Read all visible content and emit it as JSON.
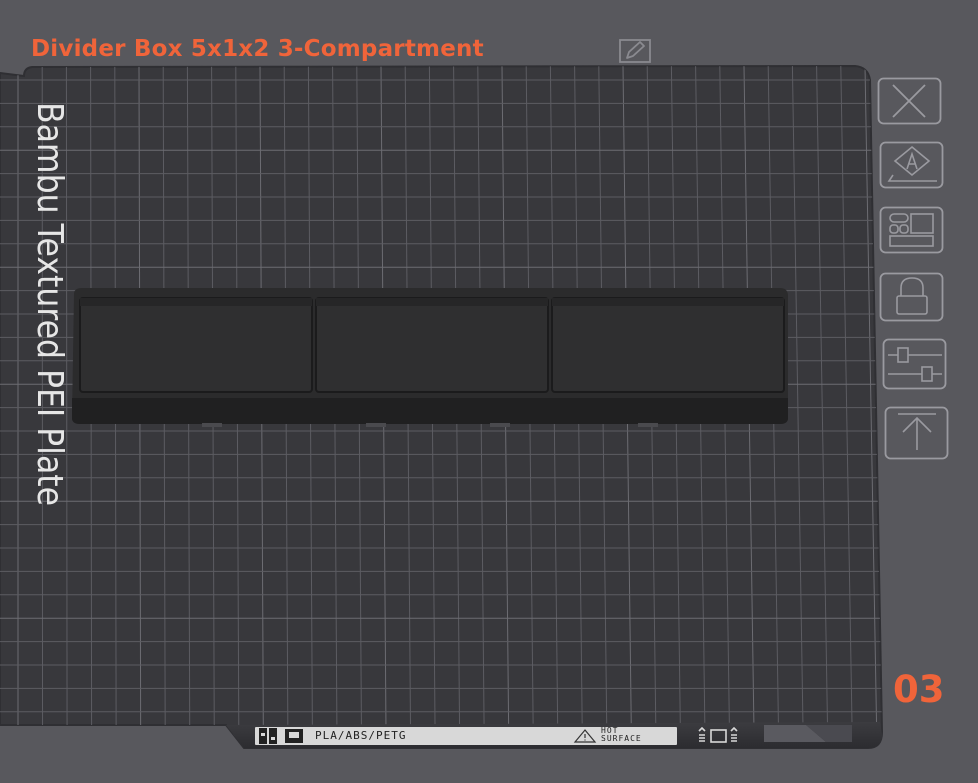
{
  "plate": {
    "title": "Divider Box 5x1x2 3-Compartment",
    "plate_type_label": "Bambu Textured PEI Plate",
    "plate_number": "03",
    "materials_label": "PLA/ABS/PETG",
    "hot_surface_line1": "HOT",
    "hot_surface_line2": "SURFACE"
  },
  "icons": {
    "edit": "edit-pencil-icon",
    "close": "close-icon",
    "auto_orient": "auto-orient-icon",
    "arrange": "arrange-icon",
    "lock": "lock-icon",
    "settings": "plate-settings-icon",
    "move_top": "move-to-top-icon"
  },
  "colors": {
    "accent": "#f0643a",
    "background": "#58585d",
    "plate": "#38383c",
    "grid": "#6a6a70",
    "model": "#2a2a2a"
  }
}
